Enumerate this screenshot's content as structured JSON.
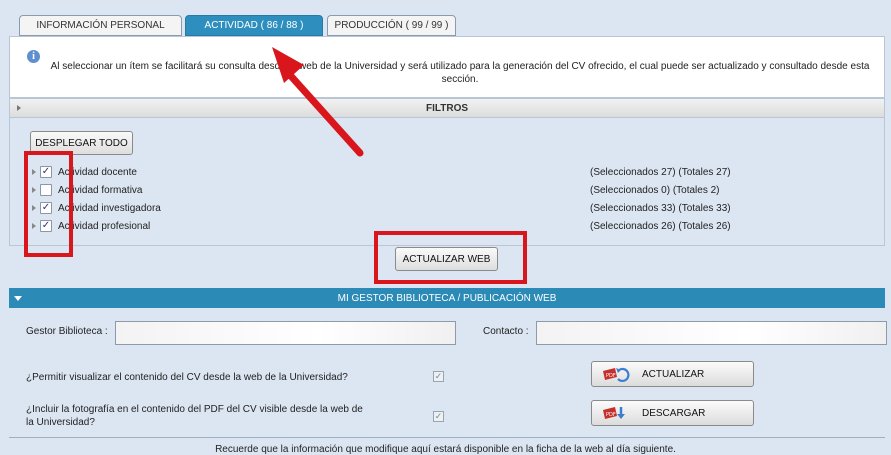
{
  "tabs": [
    {
      "label": "INFORMACIÓN PERSONAL"
    },
    {
      "label": "ACTIVIDAD ( 86 / 88 )"
    },
    {
      "label": "PRODUCCIÓN ( 99 / 99 )"
    }
  ],
  "active_tab_index": 1,
  "info": {
    "text": "Al seleccionar un ítem se facilitará su consulta desde la web de la Universidad y será utilizado para la generación del CV ofrecido, el cual puede ser actualizado y consultado desde esta sección."
  },
  "filters": {
    "header": "FILTROS",
    "expand_all_label": "DESPLEGAR TODO",
    "rows": [
      {
        "label": "Actividad docente",
        "checked": true,
        "count": "(Seleccionados 27) (Totales 27)"
      },
      {
        "label": "Actividad formativa",
        "checked": false,
        "count": "(Seleccionados 0) (Totales 2)"
      },
      {
        "label": "Actividad investigadora",
        "checked": true,
        "count": "(Seleccionados 33) (Totales 33)"
      },
      {
        "label": "Actividad profesional",
        "checked": true,
        "count": "(Seleccionados 26) (Totales 26)"
      }
    ],
    "update_web_label": "ACTUALIZAR WEB"
  },
  "library": {
    "header": "MI GESTOR BIBLIOTECA / PUBLICACIÓN WEB",
    "gestor_label": "Gestor Biblioteca :",
    "gestor_value": "",
    "contacto_label": "Contacto :",
    "contacto_value": "",
    "q1": "¿Permitir visualizar el contenido del CV desde la web de la Universidad?",
    "q1_checked": true,
    "q2": "¿Incluir la fotografía en el contenido del PDF del CV visible desde la web de la Universidad?",
    "q2_checked": true,
    "update_label": "ACTUALIZAR",
    "download_label": "DESCARGAR"
  },
  "footer": {
    "text": "Recuerde que la información que modifique aquí estará disponible en la ficha de la web al día siguiente."
  },
  "colors": {
    "accent_teal": "#2b8bb6",
    "highlight_red": "#d9161c",
    "background": "#dce6f2"
  }
}
